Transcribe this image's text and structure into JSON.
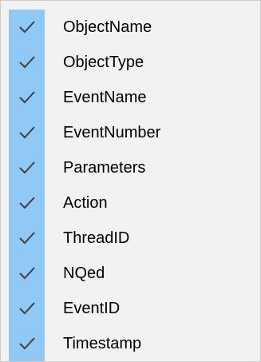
{
  "menu": {
    "checkmark_color": "#404040",
    "gutter_color": "#90c8f6",
    "items": [
      {
        "label": "ObjectName",
        "checked": true,
        "icon": "checkmark-icon"
      },
      {
        "label": "ObjectType",
        "checked": true,
        "icon": "checkmark-icon"
      },
      {
        "label": "EventName",
        "checked": true,
        "icon": "checkmark-icon"
      },
      {
        "label": "EventNumber",
        "checked": true,
        "icon": "checkmark-icon"
      },
      {
        "label": "Parameters",
        "checked": true,
        "icon": "checkmark-icon"
      },
      {
        "label": "Action",
        "checked": true,
        "icon": "checkmark-icon"
      },
      {
        "label": "ThreadID",
        "checked": true,
        "icon": "checkmark-icon"
      },
      {
        "label": "NQed",
        "checked": true,
        "icon": "checkmark-icon"
      },
      {
        "label": "EventID",
        "checked": true,
        "icon": "checkmark-icon"
      },
      {
        "label": "Timestamp",
        "checked": true,
        "icon": "checkmark-icon"
      }
    ]
  }
}
